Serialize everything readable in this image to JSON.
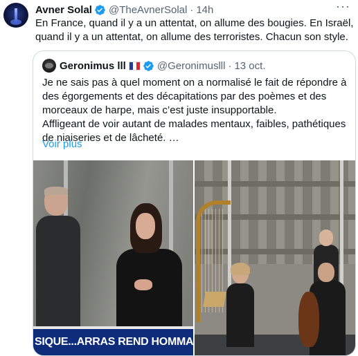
{
  "tweet": {
    "author_name": "Avner Solal",
    "author_handle": "@TheAvnerSolal",
    "separator": "·",
    "time": "14h",
    "more_icon": "more-horizontal-icon",
    "text": "En France, quand il y a un attentat, on allume des bougies. En Israël, quand il y a un attentat, on allume des terroristes. Chacun son style."
  },
  "quote": {
    "author_name": "Geronimus lll",
    "flag": "🇫🇷",
    "author_handle": "@Geronimuslll",
    "separator": "·",
    "date": "13 oct.",
    "paragraph1": "Je ne sais pas à quel moment on a normalisé le fait de répondre à des égorgements et des décapitations par des poèmes et des morceaux de harpe, mais c’est juste insupportable.",
    "paragraph2": "Affligeant de voir autant de malades mentaux, faibles, pathétiques de niaiseries et de lâcheté. …",
    "see_more": "Voir plus",
    "media_left_caption": "SIQUE...ARRAS REND HOMMAGE À D."
  },
  "colors": {
    "verified": "#1d9bf0",
    "link": "#1d9bf0",
    "muted": "#536471",
    "ticker": "#0e2c7a"
  }
}
